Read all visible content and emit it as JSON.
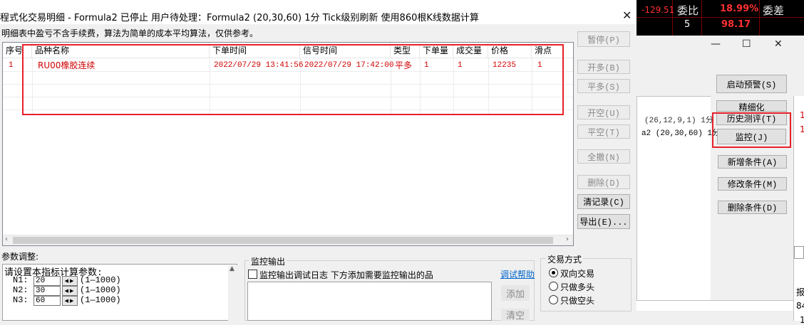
{
  "background_quote": {
    "value1": "-129.51",
    "label1": "委比",
    "value2": "18.99%",
    "label2": "委差",
    "value3": "5",
    "value4": "98.17"
  },
  "background_window": {
    "buttons": {
      "start_alert": "启动预警(S)",
      "refine": "精细化",
      "history_test": "历史测评(T)",
      "monitor": "监控(J)",
      "add_condition": "新增条件(A)",
      "modify_condition": "修改条件(M)",
      "delete_condition": "删除条件(D)"
    },
    "list_lines": [
      "(26,12,9,1) 1分",
      "a2 (20,30,60) 1分"
    ],
    "edge_chars": [
      "1",
      "1",
      "报",
      "84",
      "1"
    ]
  },
  "window": {
    "title": "程式化交易明细 - Formula2 已停止  用户待处理：Formula2 (20,30,60) 1分 Tick级别刷新 使用860根K线数据计算",
    "note": "明细表中盈亏不含手续费，算法为简单的成本平均算法，仅供参考。",
    "close_glyph": "✕"
  },
  "table": {
    "columns": [
      "序号",
      "品种名称",
      "下单时间",
      "信号时间",
      "类型",
      "下单量",
      "成交量",
      "价格",
      "滑点"
    ],
    "rows": [
      {
        "seq": "1",
        "name": "RU00橡胶连续",
        "order_time": "2022/07/29 13:41:56",
        "signal_time": "2022/07/29 17:42:00",
        "type": "平多",
        "order_qty": "1",
        "filled_qty": "1",
        "price": "12235",
        "slippage": "1"
      }
    ]
  },
  "side_buttons": {
    "pause": "暂停(P)",
    "open_long": "开多(B)",
    "close_long": "平多(S)",
    "open_short": "开空(U)",
    "close_short": "平空(T)",
    "cancel_all": "全撤(N)",
    "delete": "删除(D)",
    "clear_records": "清记录(C)",
    "export": "导出(E)..."
  },
  "params": {
    "group_label": "参数调整:",
    "prompt": "请设置本指标计算参数:",
    "items": [
      {
        "name": "N1:",
        "value": "20",
        "range": "(1—1000)"
      },
      {
        "name": "N2:",
        "value": "30",
        "range": "(1—1000)"
      },
      {
        "name": "N3:",
        "value": "60",
        "range": "(1—1000)"
      }
    ]
  },
  "monitor": {
    "group_label": "监控输出",
    "checkbox_label": "监控输出调试日志 下方添加需要监控输出的品",
    "help_link": "调试帮助",
    "add_button": "添加",
    "clear_button": "清空"
  },
  "trade_mode": {
    "group_label": "交易方式",
    "options": [
      {
        "label": "双向交易",
        "selected": true
      },
      {
        "label": "只做多头",
        "selected": false
      },
      {
        "label": "只做空头",
        "selected": false
      }
    ]
  }
}
